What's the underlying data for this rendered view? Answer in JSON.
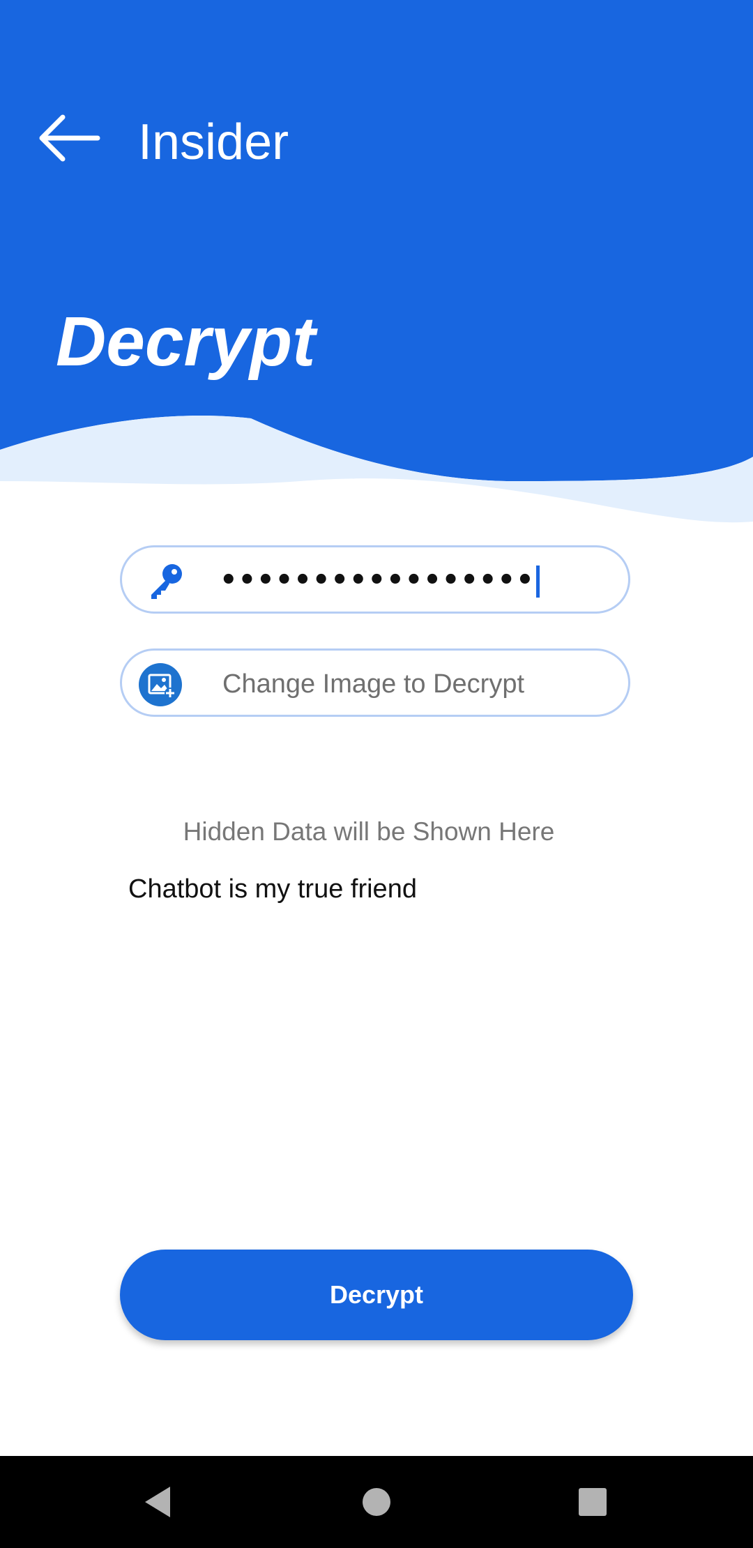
{
  "colors": {
    "primary": "#1866e0",
    "wave_light": "#e3effd",
    "field_border": "#b5cdf4",
    "nav_bar": "#000000"
  },
  "header": {
    "back_icon": "arrow-left-icon",
    "app_title": "Insider",
    "page_heading": "Decrypt"
  },
  "form": {
    "password": {
      "icon": "key-icon",
      "masked_value": "•••••••••••••••••"
    },
    "image_picker": {
      "icon": "image-add-icon",
      "label": "Change Image to Decrypt"
    }
  },
  "result": {
    "hint": "Hidden Data will be Shown Here",
    "text": "Chatbot is my true friend"
  },
  "actions": {
    "decrypt_label": "Decrypt"
  },
  "nav_bar": {
    "back_icon": "triangle-back-icon",
    "home_icon": "circle-home-icon",
    "recents_icon": "square-recents-icon"
  }
}
